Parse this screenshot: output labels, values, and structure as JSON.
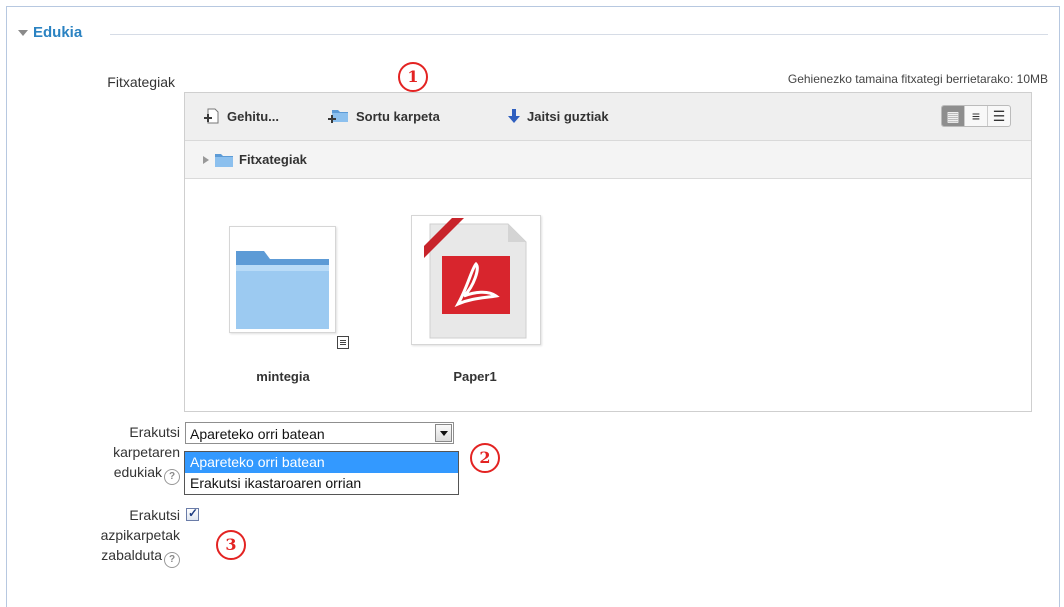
{
  "section": {
    "title": "Edukia"
  },
  "files": {
    "label": "Fitxategiak",
    "max_size": "Gehienezko tamaina fitxategi berrietarako: 10MB",
    "toolbar": {
      "add": "Gehitu...",
      "create_folder": "Sortu karpeta",
      "download_all": "Jaitsi guztiak"
    },
    "views": [
      "icons-view",
      "list-view",
      "tree-view"
    ],
    "breadcrumb": "Fitxategiak",
    "items": [
      {
        "name": "mintegia",
        "type": "folder"
      },
      {
        "name": "Paper1",
        "type": "pdf"
      }
    ]
  },
  "display": {
    "label_lines": [
      "Erakutsi",
      "karpetaren",
      "edukiak"
    ],
    "selected": "Apareteko orri batean",
    "options": [
      "Apareteko orri batean",
      "Erakutsi ikastaroaren orrian"
    ]
  },
  "expand": {
    "label_lines": [
      "Erakutsi",
      "azpikarpetak",
      "zabalduta"
    ],
    "checked": true
  },
  "markers": [
    "1",
    "2",
    "3"
  ],
  "colors": {
    "accent": "#2b83c2",
    "marker": "#e32322",
    "selection": "#3399ff"
  }
}
